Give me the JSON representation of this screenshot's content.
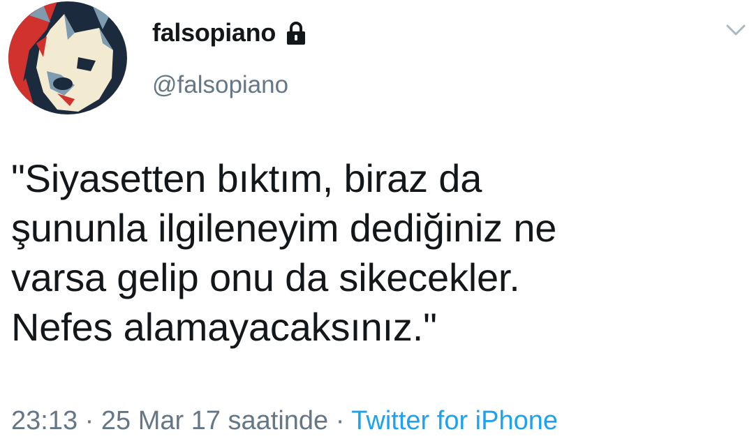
{
  "tweet": {
    "display_name": "falsopiano",
    "handle": "@falsopiano",
    "protected_icon": "lock-icon",
    "menu_icon": "chevron-down-icon",
    "avatar_icon": "dog-avatar",
    "text_lines": [
      "\"Siyasetten bıktım, biraz da",
      "şununla ilgileneyim dediğiniz ne",
      "varsa gelip onu da sikecekler.",
      "Nefes alamayacaksınız.\""
    ],
    "time": "23:13",
    "separator": "·",
    "date": "25 Mar 17 saatinde",
    "source": "Twitter for iPhone"
  },
  "colors": {
    "text": "#14171a",
    "secondary": "#657786",
    "link": "#1da1f2",
    "avatar_dark": "#1c2a3e",
    "avatar_red": "#d2322d",
    "avatar_light": "#f3ead2",
    "avatar_mid": "#7e9bb0"
  }
}
